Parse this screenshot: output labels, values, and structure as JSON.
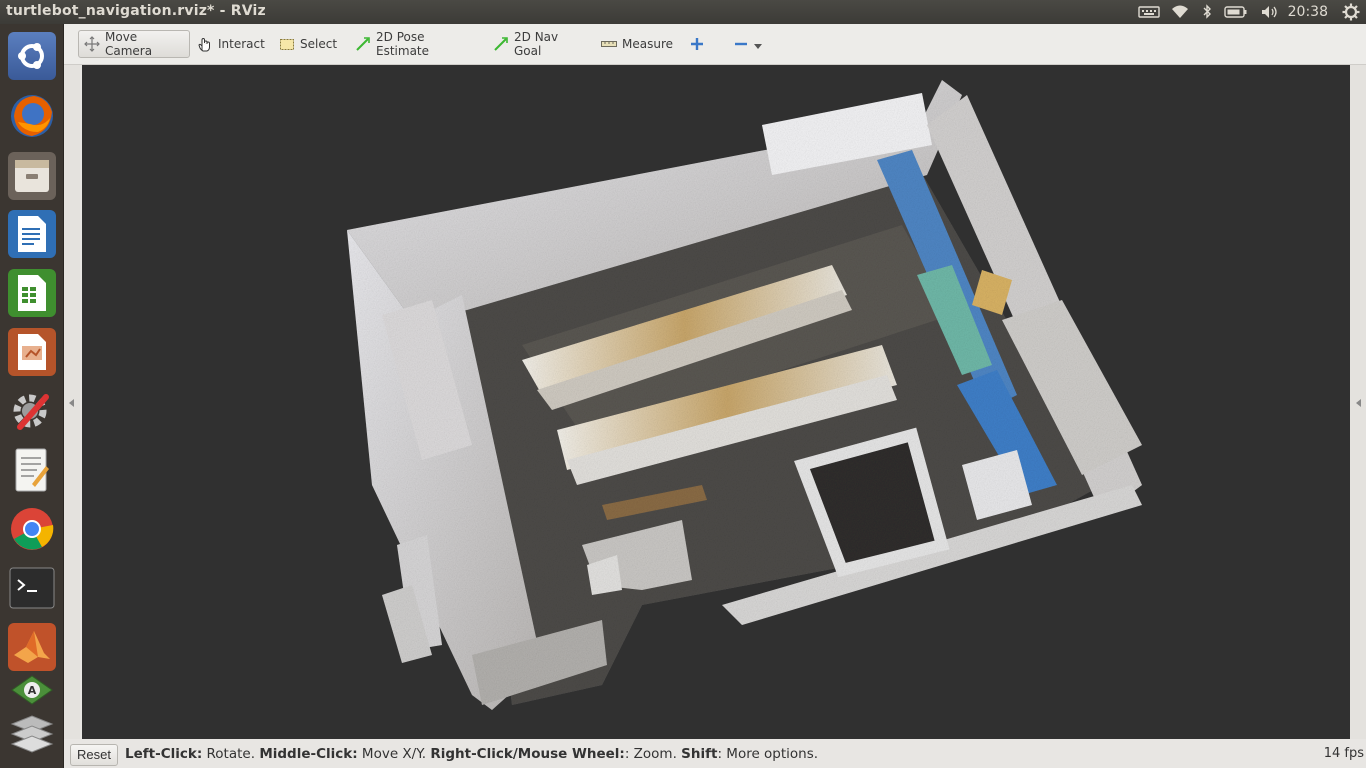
{
  "window": {
    "title": "turtlebot_navigation.rviz* - RViz"
  },
  "panel": {
    "clock": "20:38",
    "indicators": [
      "keyboard-icon",
      "wifi-icon",
      "bluetooth-icon",
      "battery-icon",
      "volume-icon",
      "settings-gear-icon"
    ]
  },
  "launcher": {
    "items": [
      "ubuntu-dash-icon",
      "firefox-icon",
      "files-icon",
      "writer-icon",
      "calc-icon",
      "impress-icon",
      "system-settings-icon",
      "text-editor-icon",
      "chrome-icon",
      "terminal-icon",
      "matlab-icon",
      "software-updater-icon",
      "workspace-switcher-icon"
    ]
  },
  "toolbar": {
    "move_camera": "Move Camera",
    "interact": "Interact",
    "select": "Select",
    "pose_estimate": "2D Pose Estimate",
    "nav_goal": "2D Nav Goal",
    "measure": "Measure"
  },
  "status": {
    "reset": "Reset",
    "hint_parts": [
      {
        "bold": "Left-Click:",
        "text": " Rotate. "
      },
      {
        "bold": "Middle-Click:",
        "text": " Move X/Y. "
      },
      {
        "bold": "Right-Click/Mouse Wheel:",
        "text": ": Zoom. "
      },
      {
        "bold": "Shift",
        "text": ": More options."
      }
    ],
    "fps": "14 fps"
  }
}
